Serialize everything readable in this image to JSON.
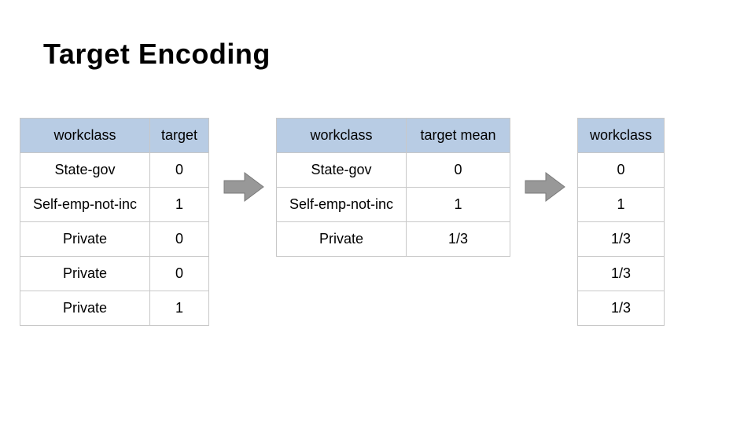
{
  "title": "Target Encoding",
  "chart_data": [
    {
      "type": "table",
      "columns": [
        "workclass",
        "target"
      ],
      "rows": [
        [
          "State-gov",
          "0"
        ],
        [
          "Self-emp-not-inc",
          "1"
        ],
        [
          "Private",
          "0"
        ],
        [
          "Private",
          "0"
        ],
        [
          "Private",
          "1"
        ]
      ]
    },
    {
      "type": "table",
      "columns": [
        "workclass",
        "target mean"
      ],
      "rows": [
        [
          "State-gov",
          "0"
        ],
        [
          "Self-emp-not-inc",
          "1"
        ],
        [
          "Private",
          "1/3"
        ]
      ]
    },
    {
      "type": "table",
      "columns": [
        "workclass"
      ],
      "rows": [
        [
          "0"
        ],
        [
          "1"
        ],
        [
          "1/3"
        ],
        [
          "1/3"
        ],
        [
          "1/3"
        ]
      ]
    }
  ]
}
